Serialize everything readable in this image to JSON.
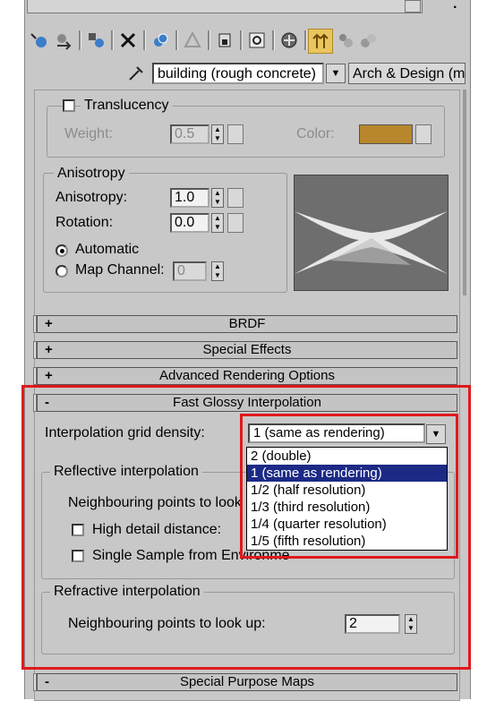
{
  "material": {
    "name": "building (rough concrete)",
    "type_button": "Arch & Design (mi)"
  },
  "translucency": {
    "label": "Translucency",
    "weight_label": "Weight:",
    "weight_value": "0.5",
    "color_label": "Color:",
    "color_swatch": "#b8862c"
  },
  "anisotropy": {
    "group_label": "Anisotropy",
    "anisotropy_label": "Anisotropy:",
    "anisotropy_value": "1.0",
    "rotation_label": "Rotation:",
    "rotation_value": "0.0",
    "automatic_label": "Automatic",
    "map_channel_label": "Map Channel:",
    "map_channel_value": "0"
  },
  "rollouts": {
    "brdf": "BRDF",
    "special_effects": "Special Effects",
    "advanced_rendering": "Advanced Rendering Options",
    "fast_glossy": "Fast Glossy Interpolation",
    "special_purpose_maps": "Special Purpose Maps",
    "plus": "+",
    "minus": "-"
  },
  "fast_glossy": {
    "grid_density_label": "Interpolation grid density:",
    "grid_density_value": "1 (same as rendering)",
    "grid_density_options": [
      "2 (double)",
      "1 (same as rendering)",
      "1/2 (half resolution)",
      "1/3 (third resolution)",
      "1/4 (quarter resolution)",
      "1/5 (fifth resolution)"
    ],
    "reflective_group": "Reflective interpolation",
    "reflective_neighbour_label": "Neighbouring points to look u",
    "high_detail_label": "High detail distance:",
    "single_sample_label": "Single Sample from Environment",
    "refractive_group": "Refractive interpolation",
    "refractive_neighbour_label": "Neighbouring points to look up:",
    "refractive_neighbour_value": "2"
  },
  "colors": {
    "highlight_red": "#e0191c",
    "selection_blue": "#1c2a86",
    "active_tool": "#e9c560"
  },
  "icons": [
    "get-material-icon",
    "assign-material-icon",
    "put-to-library-icon",
    "delete-icon",
    "make-unique-icon",
    "material-effects-icon",
    "put-to-scene-icon",
    "show-map-icon",
    "show-end-result-icon",
    "go-to-parent-icon",
    "go-forward-icon",
    "pick-material-icon",
    "eyedropper-icon"
  ]
}
